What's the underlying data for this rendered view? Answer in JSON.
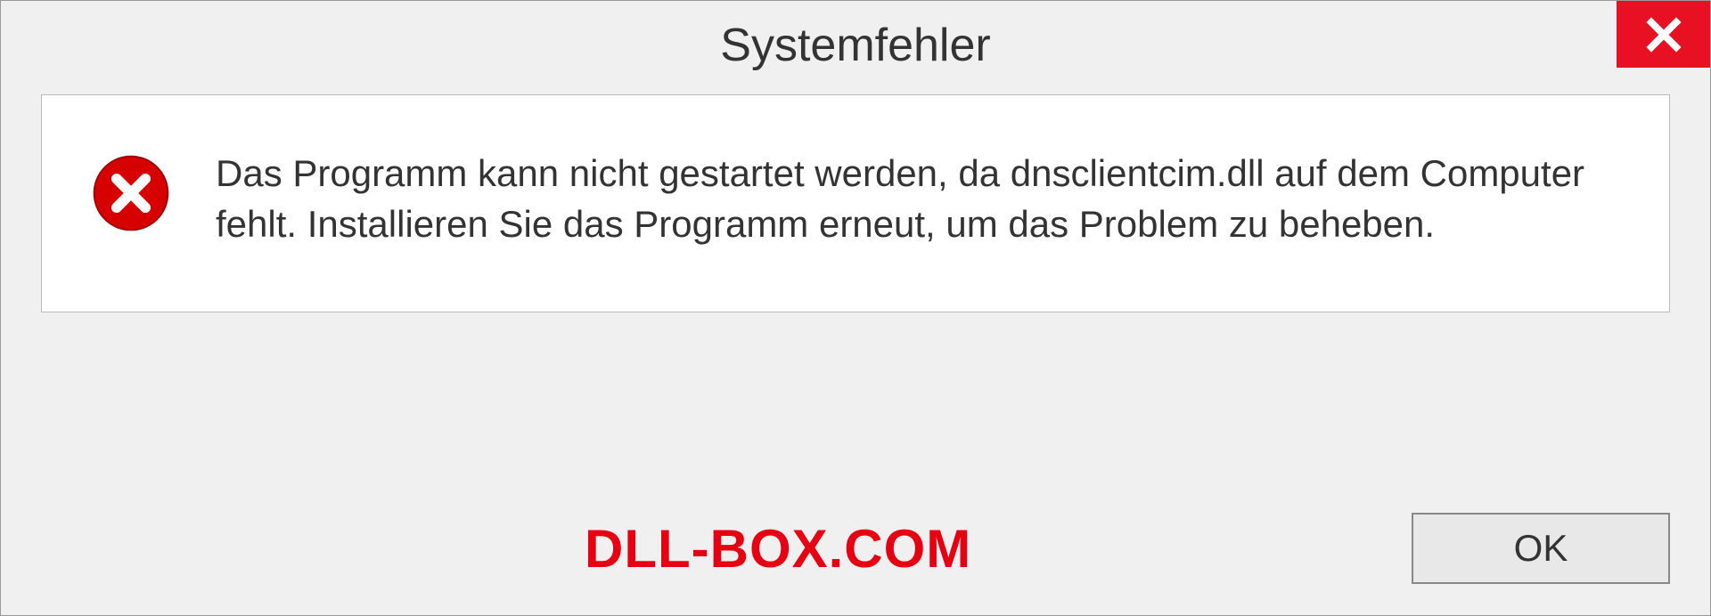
{
  "dialog": {
    "title": "Systemfehler",
    "message": "Das Programm kann nicht gestartet werden, da dnsclientcim.dll auf dem Computer fehlt. Installieren Sie das Programm erneut, um das Problem zu beheben.",
    "ok_label": "OK"
  },
  "watermark": "DLL-BOX.COM",
  "colors": {
    "close_bg": "#e81123",
    "error_red": "#d60000",
    "watermark_red": "#e60012"
  }
}
